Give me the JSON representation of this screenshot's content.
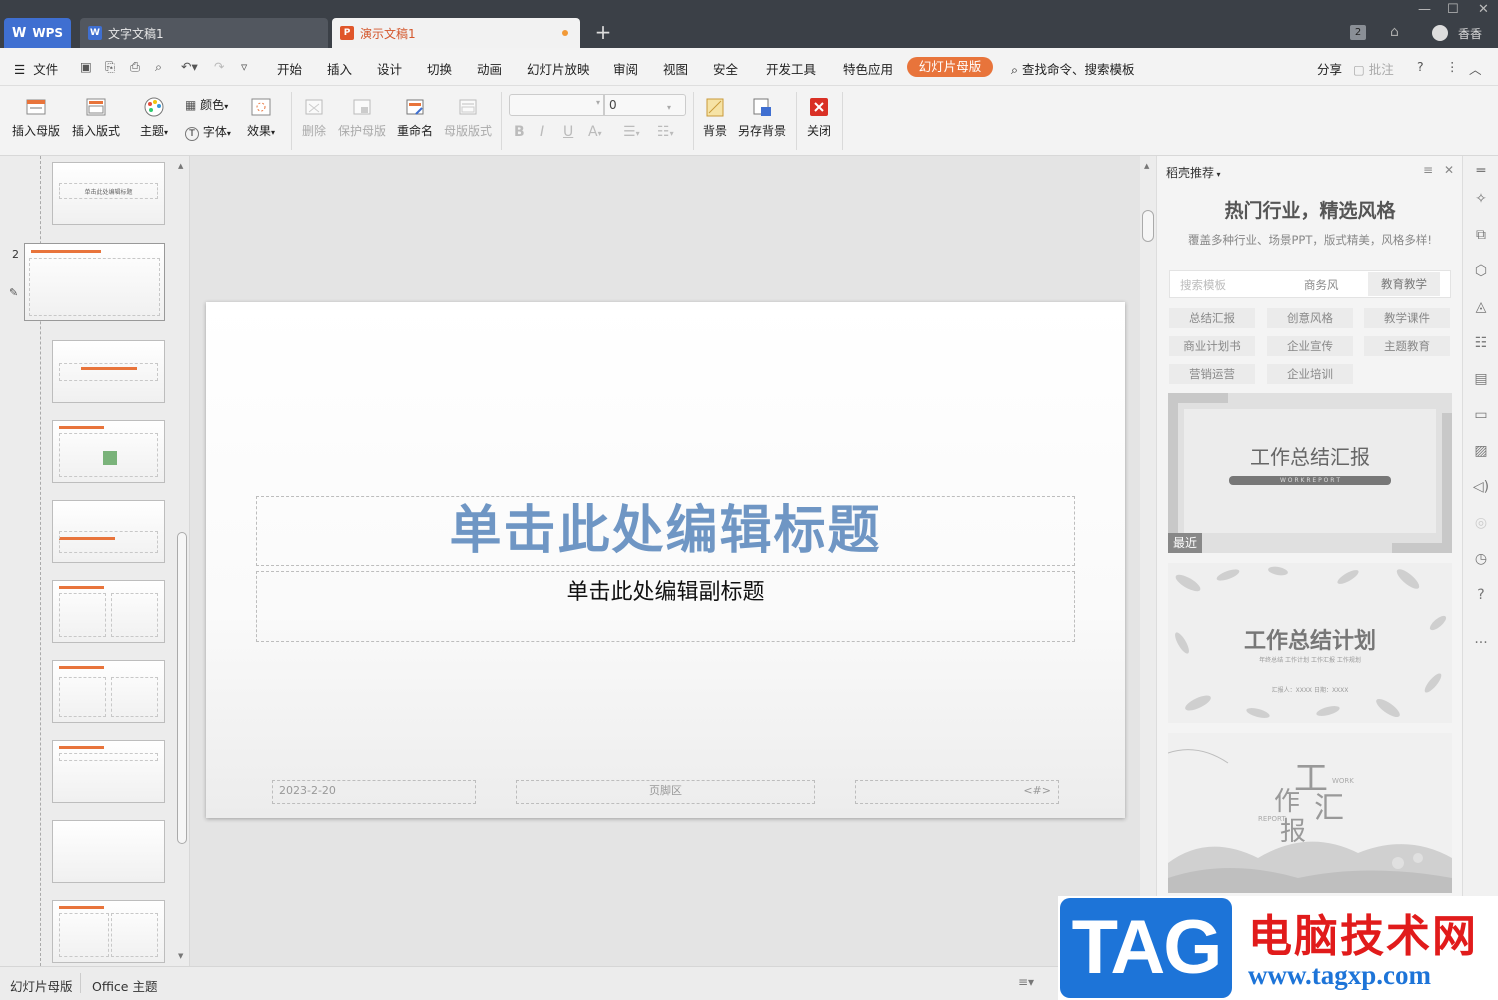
{
  "titlebar": {
    "tabs": [
      {
        "label": "WPS"
      },
      {
        "label": "文字文稿1"
      },
      {
        "label": "演示文稿1"
      }
    ],
    "user": "香香",
    "badge": "2"
  },
  "menubar": {
    "file": "文件",
    "items": [
      "开始",
      "插入",
      "设计",
      "切换",
      "动画",
      "幻灯片放映",
      "审阅",
      "视图",
      "安全",
      "开发工具",
      "特色应用"
    ],
    "active": "幻灯片母版",
    "search": "查找命令、搜索模板",
    "share": "分享",
    "comment": "批注"
  },
  "ribbon": {
    "insert_master": "插入母版",
    "insert_layout": "插入版式",
    "theme": "主题",
    "color": "颜色",
    "font": "字体",
    "effect": "效果",
    "delete": "删除",
    "protect": "保护母版",
    "rename": "重命名",
    "master_layout": "母版版式",
    "font_size": "0",
    "background": "背景",
    "save_bg": "另存背景",
    "close": "关闭"
  },
  "thumbs": {
    "slide_number": "2",
    "first_title": "单击此处编辑标题"
  },
  "slide": {
    "title": "单击此处编辑标题",
    "subtitle": "单击此处编辑副标题",
    "date": "2023-2-20",
    "footer": "页脚区",
    "number": "<#>"
  },
  "panel": {
    "title": "稻壳推荐",
    "heading": "热门行业，精选风格",
    "description": "覆盖多种行业、场景PPT，版式精美，风格多样!",
    "search_placeholder": "搜索模板",
    "search_tags": [
      "商务风",
      "教育教学"
    ],
    "categories": [
      "总结汇报",
      "创意风格",
      "教学课件",
      "商业计划书",
      "企业宣传",
      "主题教育",
      "营销运营",
      "企业培训"
    ],
    "templates": [
      {
        "title": "工作总结汇报",
        "sub": "W O R K   R E P O R T",
        "badge": "最近"
      },
      {
        "title": "工作总结计划",
        "sub": "年终总结  工作计划  工作汇报  工作规划",
        "sub2": "汇报人：XXXX     日期：XXXX"
      },
      {
        "title_chars": [
          "工",
          "作",
          "汇",
          "报"
        ],
        "en1": "WORK",
        "en2": "REPORT"
      }
    ]
  },
  "statusbar": {
    "view": "幻灯片母版",
    "theme": "Office 主题"
  },
  "watermark": {
    "tag": "TAG",
    "cn": "电脑技术网",
    "url": "www.tagxp.com"
  },
  "colors": {
    "accent": "#e8743b",
    "titlebar": "#3b4047",
    "wps_blue": "#3f6fd1",
    "slide_title": "#6f96c4"
  }
}
